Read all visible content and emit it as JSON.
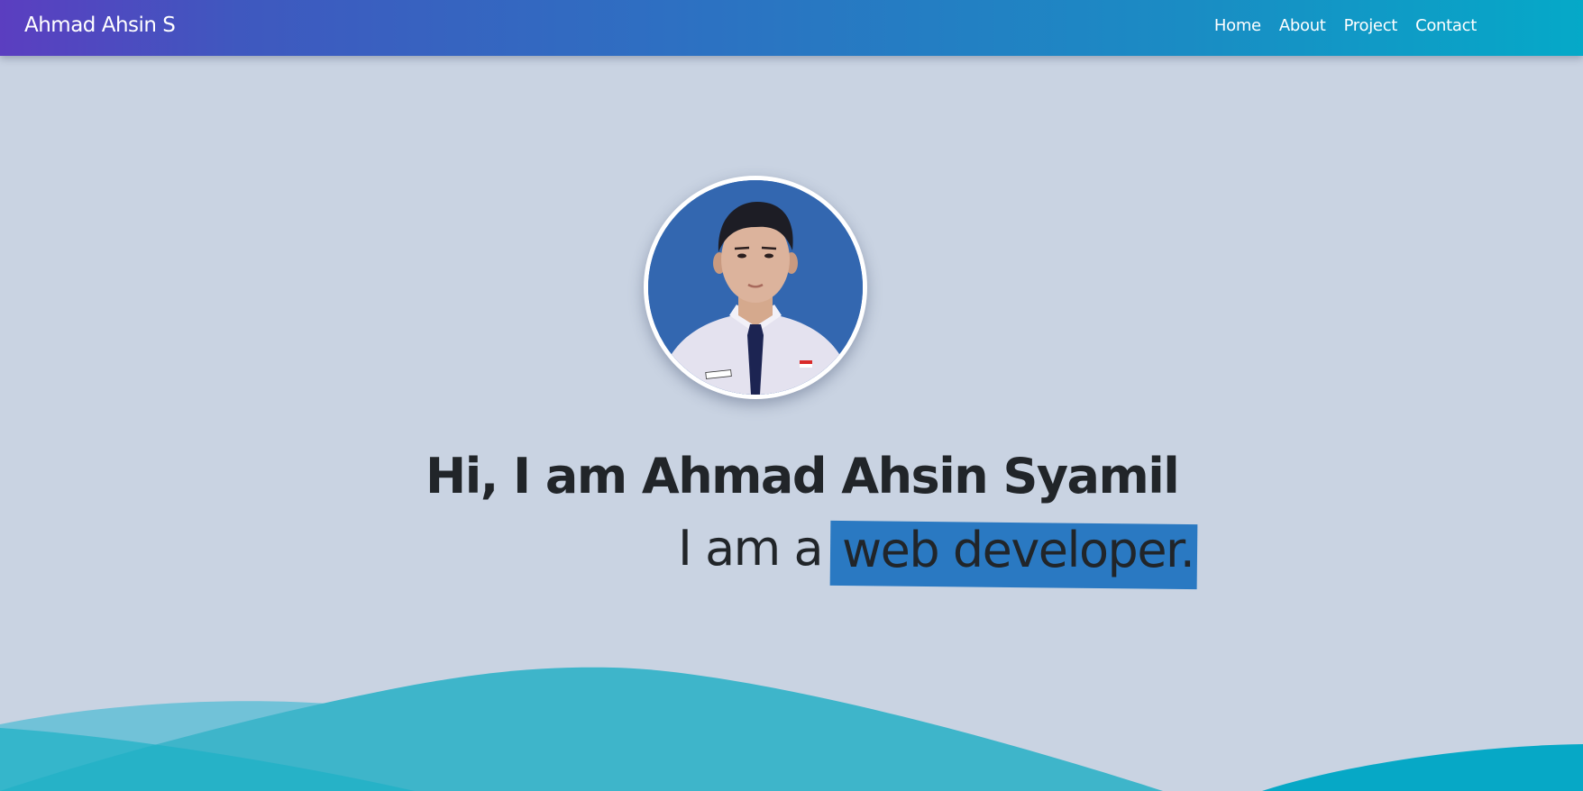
{
  "navbar": {
    "brand": "Ahmad Ahsin S",
    "links": [
      "Home",
      "About",
      "Project",
      "Contact"
    ]
  },
  "hero": {
    "greeting": "Hi, I am Ahmad Ahsin Syamil",
    "role_prefix": "I am a",
    "role_highlight": "web developer."
  },
  "colors": {
    "background": "#c9d3e2",
    "highlight": "#2a79c2",
    "wave": "#17aec5",
    "text": "#212529"
  },
  "icons": {
    "avatar": "profile-photo"
  }
}
